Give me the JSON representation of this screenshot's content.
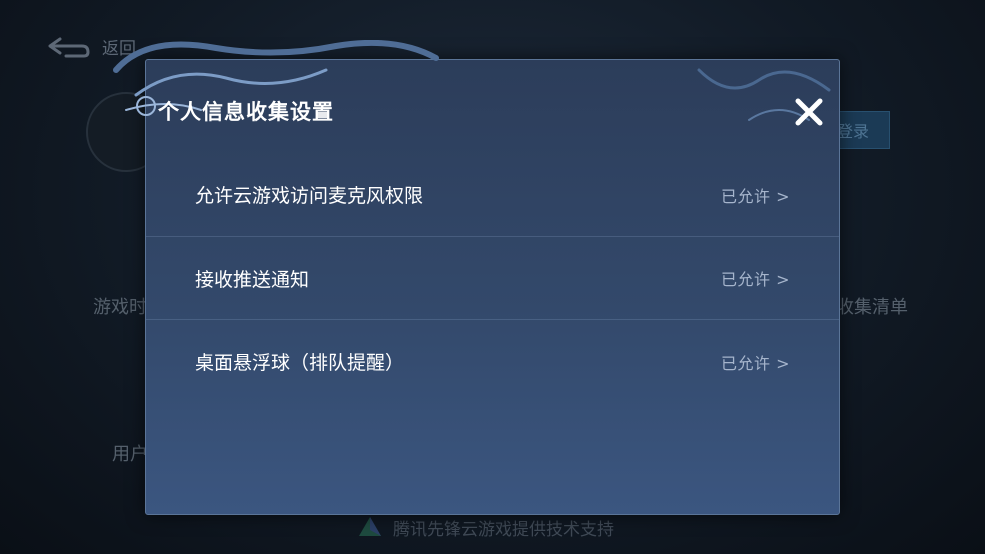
{
  "background": {
    "back_label": "返回",
    "login_label": "登录",
    "game_time_label": "游戏时",
    "collect_list_label": "收集清单",
    "user_label": "用户",
    "footer_text": "腾讯先锋云游戏提供技术支持"
  },
  "dialog": {
    "title": "个人信息收集设置",
    "close_icon": "close-icon",
    "items": [
      {
        "label": "允许云游戏访问麦克风权限",
        "status": "已允许 >"
      },
      {
        "label": "接收推送通知",
        "status": "已允许 >"
      },
      {
        "label": "桌面悬浮球（排队提醒）",
        "status": "已允许 >"
      }
    ]
  },
  "colors": {
    "dialog_bg": "#33496b",
    "dialog_border": "#5b7598",
    "text_primary": "#ffffff",
    "text_status": "#a6b5cc"
  }
}
